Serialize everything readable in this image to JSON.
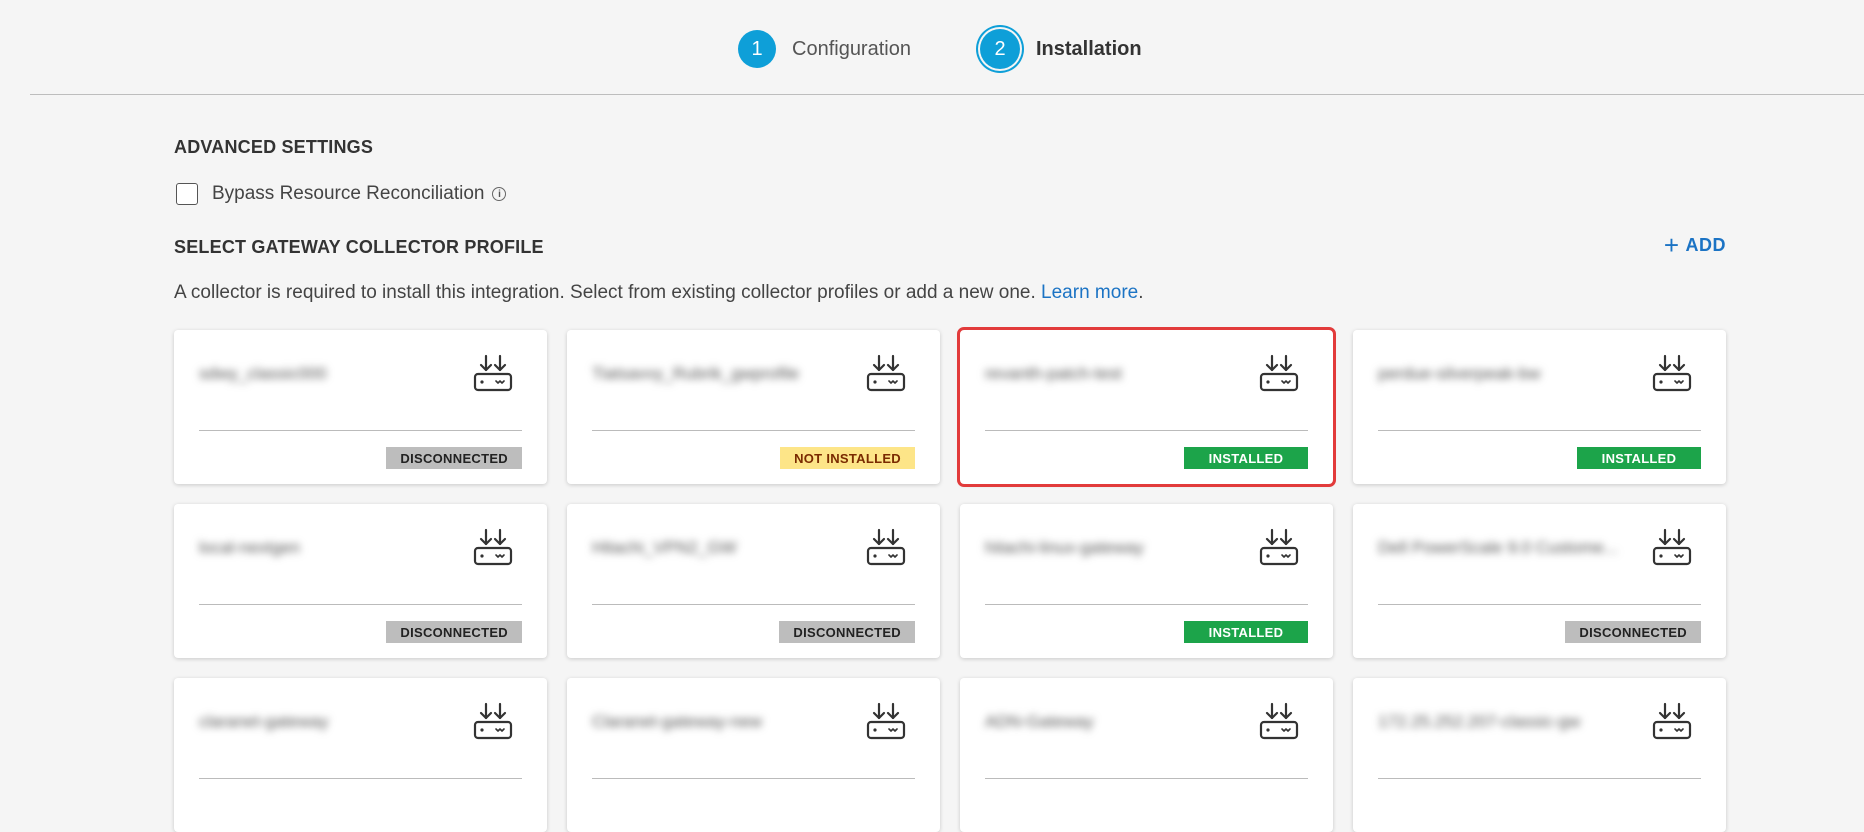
{
  "stepper": {
    "steps": [
      {
        "number": "1",
        "label": "Configuration"
      },
      {
        "number": "2",
        "label": "Installation"
      }
    ]
  },
  "advanced_settings": {
    "heading": "ADVANCED SETTINGS",
    "bypass_label": "Bypass Resource Reconciliation",
    "info_glyph": "i"
  },
  "gateway": {
    "heading": "SELECT GATEWAY COLLECTOR PROFILE",
    "add_label": "ADD",
    "description": "A collector is required to install this integration. Select from existing collector profiles or add a new one.",
    "learn_more": "Learn more",
    "description_end": "."
  },
  "colors": {
    "accent": "#0e9fd8",
    "link": "#1b73c4",
    "installed": "#1ca44a",
    "not_installed": "#fde588",
    "disconnected": "#bdbdbd",
    "selection": "#e23b3b"
  },
  "cards": [
    {
      "name": "sdwy_classic000",
      "status": "DISCONNECTED"
    },
    {
      "name": "Tiatsavvy_Rubrik_gwprofile",
      "status": "NOT INSTALLED"
    },
    {
      "name": "revanth-patch-test",
      "status": "INSTALLED"
    },
    {
      "name": "perdue-silverpeak-bw",
      "status": "INSTALLED"
    },
    {
      "name": "local-nextgen",
      "status": "DISCONNECTED"
    },
    {
      "name": "Hitachi_VPN2_GW",
      "status": "DISCONNECTED"
    },
    {
      "name": "hitachi-linux-gateway",
      "status": "INSTALLED"
    },
    {
      "name": "Dell PowerScale 9.0 Custome...",
      "status": "DISCONNECTED"
    },
    {
      "name": "claranet-gateway",
      "status": ""
    },
    {
      "name": "Claranet-gateway-new",
      "status": ""
    },
    {
      "name": "ADN-Gateway",
      "status": ""
    },
    {
      "name": "172.25.252.207-classic-gw",
      "status": ""
    }
  ]
}
